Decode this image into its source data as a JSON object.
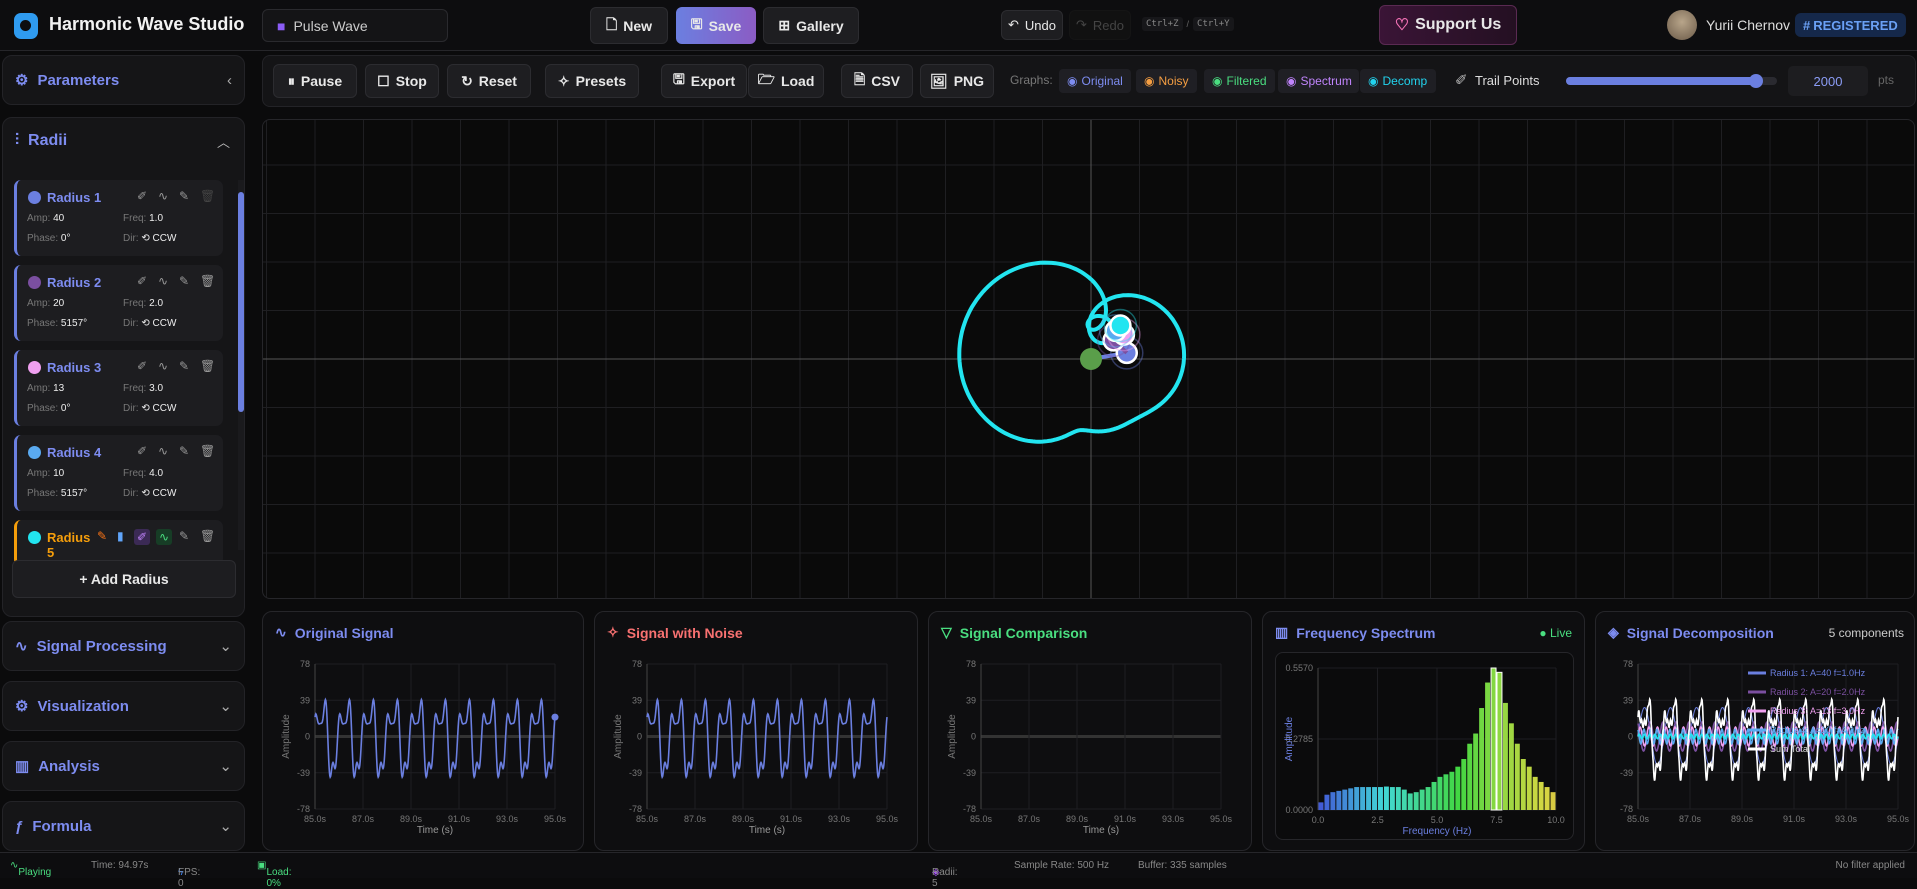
{
  "header": {
    "app_title": "Harmonic Wave Studio",
    "preset_name": "Pulse Wave",
    "new_label": "New",
    "save_label": "Save",
    "gallery_label": "Gallery",
    "undo_label": "Undo",
    "redo_label": "Redo",
    "undo_shortcut": "Ctrl+Z",
    "shortcut_sep": "/",
    "redo_shortcut": "Ctrl+Y",
    "support_label": "Support Us",
    "user_name": "Yurii Chernov",
    "badge": "REGISTERED"
  },
  "sidebar": {
    "parameters_label": "Parameters",
    "radii_label": "Radii",
    "add_radius_label": "+ Add Radius",
    "radii": [
      {
        "name": "Radius 1",
        "color": "#6b7fe0",
        "amp": "40",
        "freq": "1.0",
        "phase": "0°",
        "dir": "CCW"
      },
      {
        "name": "Radius 2",
        "color": "#7b4fa0",
        "amp": "20",
        "freq": "2.0",
        "phase": "5157°",
        "dir": "CCW"
      },
      {
        "name": "Radius 3",
        "color": "#f0a0f0",
        "amp": "13",
        "freq": "3.0",
        "phase": "0°",
        "dir": "CCW"
      },
      {
        "name": "Radius 4",
        "color": "#5aaaf0",
        "amp": "10",
        "freq": "4.0",
        "phase": "5157°",
        "dir": "CCW"
      },
      {
        "name": "Radius 5",
        "color": "#22e5f0",
        "active": true
      }
    ],
    "labels": {
      "amp": "Amp:",
      "freq": "Freq:",
      "phase": "Phase:",
      "dir": "Dir:"
    },
    "sections": [
      "Signal Processing",
      "Visualization",
      "Analysis",
      "Formula"
    ]
  },
  "toolbar": {
    "pause": "Pause",
    "stop": "Stop",
    "reset": "Reset",
    "presets": "Presets",
    "export": "Export",
    "load": "Load",
    "csv": "CSV",
    "png": "PNG",
    "graphs_label": "Graphs:",
    "graphs": [
      {
        "label": "Original",
        "color": "#7d8cf0"
      },
      {
        "label": "Noisy",
        "color": "#f59e42"
      },
      {
        "label": "Filtered",
        "color": "#4ade80"
      },
      {
        "label": "Spectrum",
        "color": "#c084fc"
      },
      {
        "label": "Decomp",
        "color": "#22d3ee"
      }
    ],
    "trail_label": "Trail Points",
    "trail_value": "2000",
    "trail_unit": "pts",
    "trail_fraction": 0.9
  },
  "colors": {
    "accent": "#6b7fe0",
    "trail": "#22e5f0",
    "center": "#5a9e4a"
  },
  "panels": {
    "original": "Original Signal",
    "noisy": "Signal with Noise",
    "comparison": "Signal Comparison",
    "spectrum": "Frequency Spectrum",
    "spectrum_status": "Live",
    "decomp": "Signal Decomposition",
    "decomp_count": "5 components"
  },
  "chart_data": [
    {
      "type": "line",
      "title": "Original Signal",
      "xlabel": "Time (s)",
      "ylabel": "Amplitude",
      "xlim": [
        85,
        95
      ],
      "ylim": [
        -78,
        78
      ],
      "xticks": [
        "85.0s",
        "87.0s",
        "89.0s",
        "91.0s",
        "93.0s",
        "95.0s"
      ],
      "yticks": [
        "78",
        "39",
        "0",
        "-39",
        "-78"
      ],
      "color": "#6b7fe0"
    },
    {
      "type": "line",
      "title": "Signal with Noise",
      "xlabel": "Time (s)",
      "ylabel": "Amplitude",
      "xlim": [
        85,
        95
      ],
      "ylim": [
        -78,
        78
      ],
      "xticks": [
        "85.0s",
        "87.0s",
        "89.0s",
        "91.0s",
        "93.0s",
        "95.0s"
      ],
      "yticks": [
        "78",
        "39",
        "0",
        "-39",
        "-78"
      ],
      "color": "#6b7fe0"
    },
    {
      "type": "line",
      "title": "Signal Comparison",
      "xlabel": "Time (s)",
      "ylabel": "Amplitude",
      "xlim": [
        85,
        95
      ],
      "ylim": [
        -78,
        78
      ],
      "xticks": [
        "85.0s",
        "87.0s",
        "89.0s",
        "91.0s",
        "93.0s",
        "95.0s"
      ],
      "yticks": [
        "78",
        "39",
        "0",
        "-39",
        "-78"
      ]
    },
    {
      "type": "bar",
      "title": "Frequency Spectrum",
      "xlabel": "Frequency (Hz)",
      "ylabel": "Amplitude",
      "xlim": [
        0,
        10
      ],
      "ylim": [
        0,
        0.557
      ],
      "xticks": [
        "0.0",
        "2.5",
        "5.0",
        "7.5",
        "10.0"
      ],
      "yticks": [
        "0.5570",
        "0.2785",
        "0.0000"
      ],
      "values": [
        0.03,
        0.06,
        0.07,
        0.075,
        0.08,
        0.085,
        0.09,
        0.09,
        0.09,
        0.09,
        0.09,
        0.092,
        0.09,
        0.09,
        0.08,
        0.065,
        0.07,
        0.08,
        0.09,
        0.11,
        0.13,
        0.14,
        0.15,
        0.17,
        0.2,
        0.26,
        0.3,
        0.4,
        0.5,
        0.557,
        0.54,
        0.42,
        0.34,
        0.26,
        0.2,
        0.17,
        0.13,
        0.11,
        0.09,
        0.07
      ]
    },
    {
      "type": "line",
      "title": "Signal Decomposition",
      "xlim": [
        85,
        95
      ],
      "ylim": [
        -78,
        78
      ],
      "xticks": [
        "85.0s",
        "87.0s",
        "89.0s",
        "91.0s",
        "93.0s",
        "95.0s"
      ],
      "yticks": [
        "78",
        "39",
        "0",
        "-39",
        "-78"
      ],
      "legend": [
        "Radius 1: A=40 f=1.0Hz",
        "Radius 2: A=20 f=2.0Hz",
        "Radius 3: A=13 f=3.0Hz",
        "Radius 4: A=10 f=4.0Hz",
        "Sum Total"
      ]
    }
  ],
  "status": {
    "state": "Playing",
    "time": "Time: 94.97s",
    "fps": "FPS: 0",
    "load": "Load: 0%",
    "radii": "Radii: 5",
    "sample_rate": "Sample Rate: 500 Hz",
    "buffer": "Buffer: 335 samples",
    "filter": "No filter applied"
  }
}
